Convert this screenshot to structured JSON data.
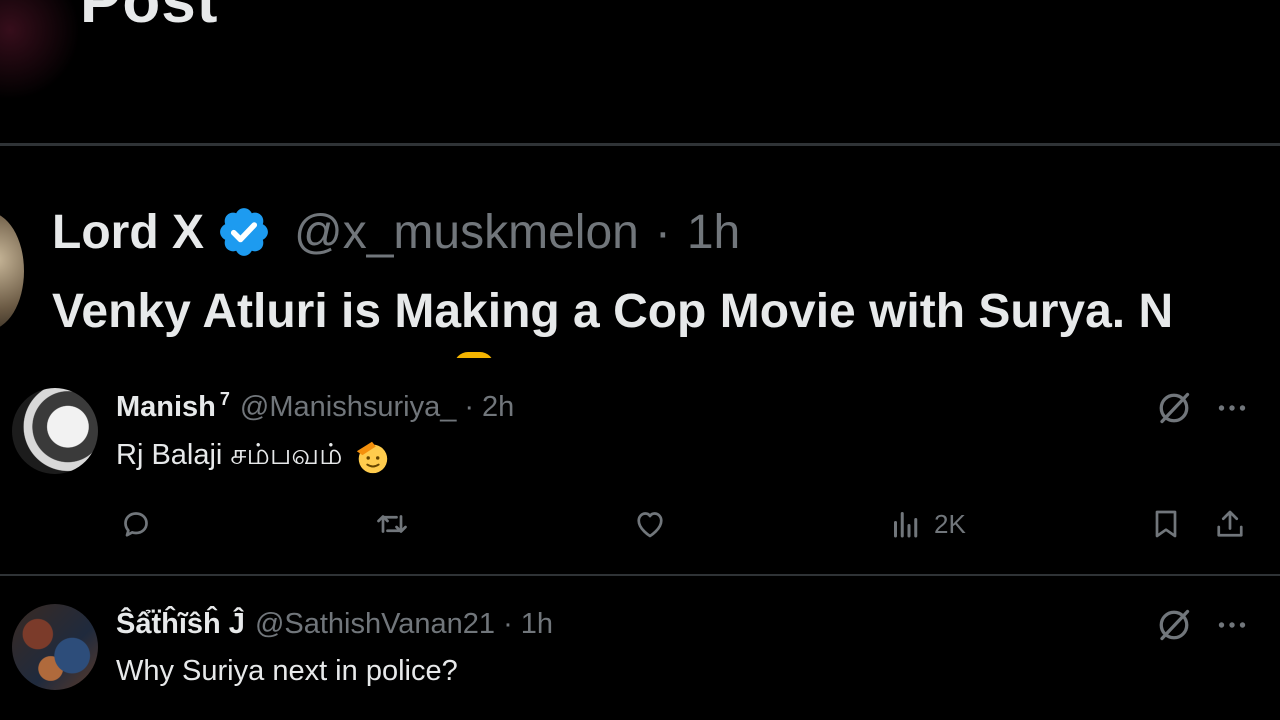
{
  "page": {
    "title": "Post"
  },
  "main_post": {
    "name": "Lord X",
    "handle": "@x_muskmelon",
    "separator": "·",
    "time": "1h",
    "text": "Venky Atluri is Making a Cop Movie with Surya. N"
  },
  "replies": [
    {
      "name": "Manish",
      "name_superscript": "7",
      "handle": "@Manishsuriya_",
      "separator": "·",
      "time": "2h",
      "text": "Rj Balaji சம்பவம்",
      "emoji": "saluting-face-emoji",
      "views": "2K"
    },
    {
      "name": "Ŝẩẗĥĩŝĥ Ĵ",
      "handle": "@SathishVanan21",
      "separator": "·",
      "time": "1h",
      "text": "Why Suriya next in police?"
    }
  ],
  "icons": {
    "verified": "verified-badge-icon",
    "grok": "grok-icon",
    "more": "more-icon",
    "reply": "reply-icon",
    "repost": "repost-icon",
    "like": "like-icon",
    "views": "views-icon",
    "bookmark": "bookmark-icon",
    "share": "share-icon"
  },
  "colors": {
    "background": "#000000",
    "text": "#e7e9ea",
    "muted": "#71767b",
    "verified": "#1d9bf0",
    "divider": "#2f3336"
  }
}
